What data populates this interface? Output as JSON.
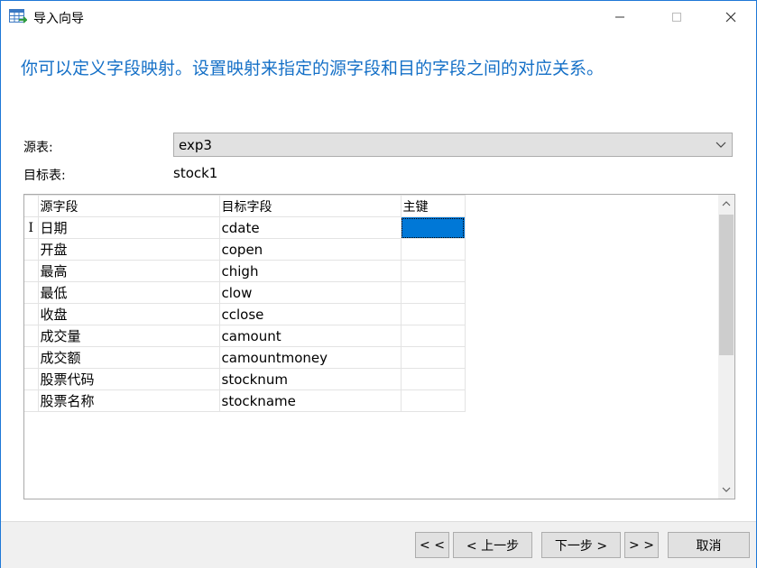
{
  "window": {
    "title": "导入向导",
    "minimize_glyph": "—",
    "maximize_glyph": "☐",
    "close_glyph": "✕"
  },
  "heading": "你可以定义字段映射。设置映射来指定的源字段和目的字段之间的对应关系。",
  "source": {
    "label": "源表:",
    "value": "exp3"
  },
  "target": {
    "label": "目标表:",
    "value": "stock1"
  },
  "grid": {
    "headers": [
      "源字段",
      "目标字段",
      "主键"
    ],
    "current_row_marker": "I",
    "rows": [
      {
        "source": "日期",
        "target": "cdate",
        "pk": ""
      },
      {
        "source": "开盘",
        "target": "copen",
        "pk": ""
      },
      {
        "source": "最高",
        "target": "chigh",
        "pk": ""
      },
      {
        "source": "最低",
        "target": "clow",
        "pk": ""
      },
      {
        "source": "收盘",
        "target": "cclose",
        "pk": ""
      },
      {
        "source": "成交量",
        "target": "camount",
        "pk": ""
      },
      {
        "source": "成交额",
        "target": "camountmoney",
        "pk": ""
      },
      {
        "source": "股票代码",
        "target": "stocknum",
        "pk": ""
      },
      {
        "source": "股票名称",
        "target": "stockname",
        "pk": ""
      }
    ]
  },
  "buttons": {
    "first": "< <",
    "prev": "< 上一步",
    "next": "下一步 >",
    "last": "> >",
    "cancel": "取消"
  },
  "colors": {
    "accent": "#1570c7",
    "selection": "#0078d7",
    "footer_bg": "#f0f0f0"
  },
  "icons": [
    "table-import-icon",
    "chevron-down-icon",
    "scroll-up-arrow-icon",
    "scroll-down-arrow-icon"
  ]
}
